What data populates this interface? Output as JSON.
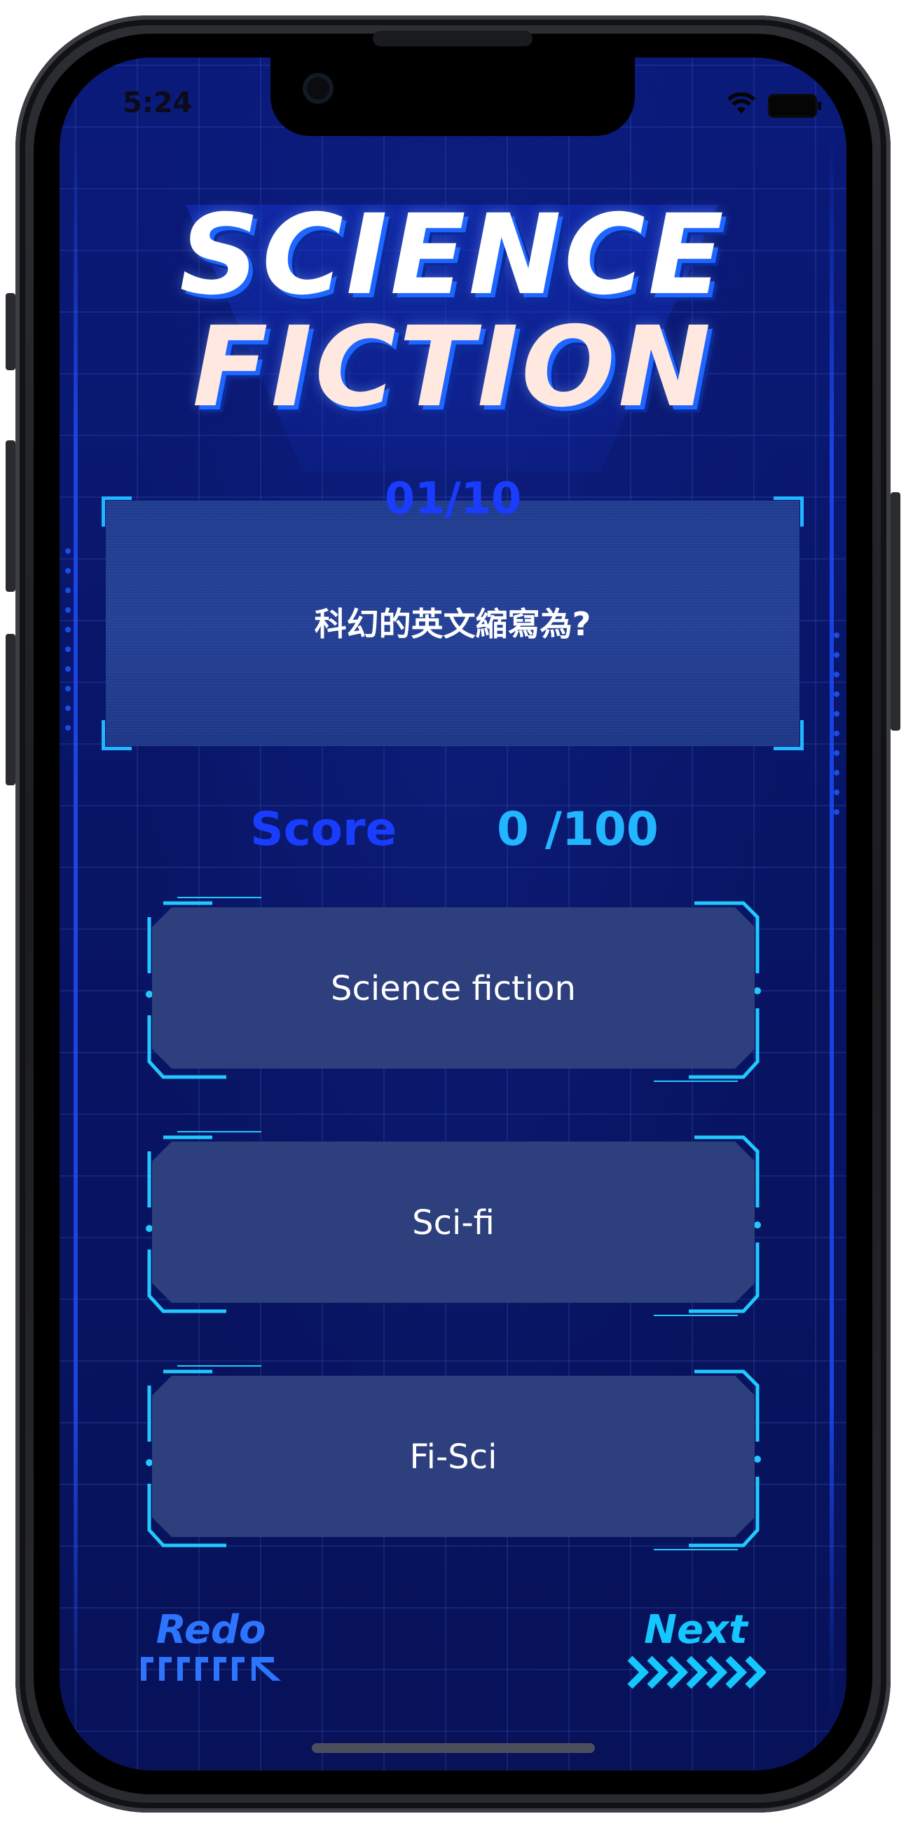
{
  "status_bar": {
    "time": "5:24",
    "icons": [
      "wifi-icon",
      "battery-icon"
    ]
  },
  "header": {
    "title_line1": "SCIENCE",
    "title_line2": "FICTION"
  },
  "question": {
    "number": "01/10",
    "text": "科幻的英文縮寫為?"
  },
  "score": {
    "label": "Score",
    "value": "0 /100"
  },
  "answers": [
    {
      "label": "Science fiction"
    },
    {
      "label": "Sci-fi"
    },
    {
      "label": "Fi-Sci"
    }
  ],
  "controls": {
    "redo_label": "Redo",
    "next_label": "Next"
  },
  "colors": {
    "background": "#081565",
    "accent_blue": "#1a3cff",
    "accent_cyan": "#21b6ff",
    "answer_fill": "#2d3f7c"
  }
}
